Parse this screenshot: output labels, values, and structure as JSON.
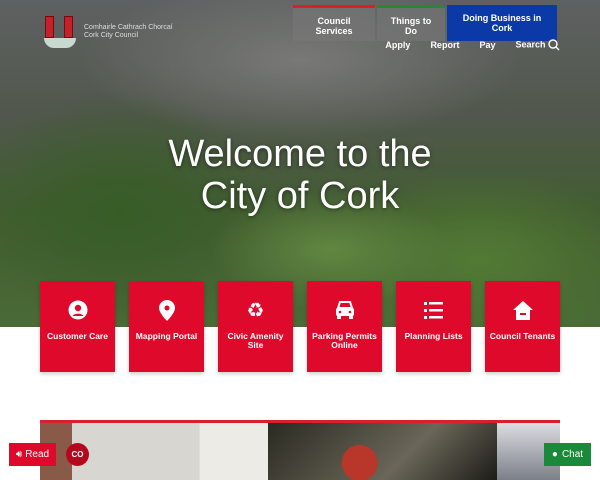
{
  "logo": {
    "line1": "Comhairle Cathrach Chorcaí",
    "line2": "Cork City Council"
  },
  "main_nav": [
    {
      "label": "Council Services"
    },
    {
      "label": "Things to Do"
    },
    {
      "label": "Doing Business in Cork"
    }
  ],
  "utility_nav": [
    {
      "label": "Apply"
    },
    {
      "label": "Report"
    },
    {
      "label": "Pay"
    },
    {
      "label": "Search"
    }
  ],
  "hero": {
    "line1": "Welcome to the",
    "line2": "City of Cork"
  },
  "tiles": [
    {
      "label": "Customer Care",
      "icon": "user-circle-icon"
    },
    {
      "label": "Mapping Portal",
      "icon": "map-pin-icon"
    },
    {
      "label": "Civic Amenity Site",
      "icon": "recycle-icon"
    },
    {
      "label": "Parking Permits Online",
      "icon": "car-icon"
    },
    {
      "label": "Planning Lists",
      "icon": "list-icon"
    },
    {
      "label": "Council Tenants",
      "icon": "house-icon"
    }
  ],
  "floating": {
    "read": "Read",
    "co": "CO",
    "chat": "Chat"
  },
  "colors": {
    "red": "#df0a2b",
    "blue": "#0b3aa8",
    "green": "#1a8a3a"
  }
}
